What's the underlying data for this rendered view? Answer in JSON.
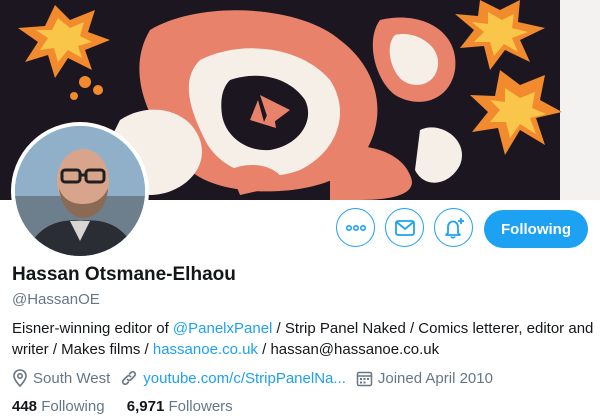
{
  "profile": {
    "name": "Hassan Otsmane-Elhaou",
    "handle": "@HassanOE",
    "bio": {
      "prefix": "Eisner-winning editor of ",
      "mention": "@PanelxPanel",
      "middle": " / Strip Panel Naked / Comics letterer, editor and writer / Makes films / ",
      "link": "hassanoe.co.uk",
      "suffix": " / hassan@hassanoe.co.uk"
    },
    "location": "South West",
    "website": "youtube.com/c/StripPanelNa...",
    "joined": "Joined April 2010"
  },
  "stats": {
    "following_count": "448",
    "following_label": "Following",
    "followers_count": "6,971",
    "followers_label": "Followers"
  },
  "actions": {
    "following_label": "Following",
    "more_icon": "more-icon",
    "message_icon": "envelope-icon",
    "notify_icon": "bell-plus-icon"
  },
  "colors": {
    "accent": "#1da1f2",
    "secondary_text": "#657786",
    "primary_text": "#14171a"
  }
}
